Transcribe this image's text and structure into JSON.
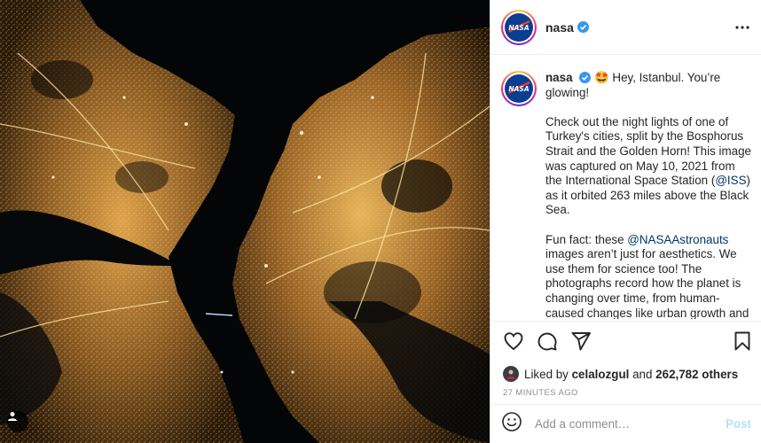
{
  "account": {
    "username": "nasa",
    "verified": true
  },
  "header": {
    "more_label": "More options"
  },
  "caption": {
    "username": "nasa",
    "emoji": "🤩",
    "line1": "Hey, Istanbul. You’re glowing!",
    "para2_a": "Check out the night lights of one of Turkey's cities, split by the Bosphorus Strait and the Golden Horn! This image was captured on May 10, 2021 from the International Space Station (",
    "mention_iss": "@ISS",
    "para2_b": ") as it orbited 263 miles above the Black Sea.",
    "para3_a": "Fun fact: these ",
    "mention_astronauts": "@NASAAstronauts",
    "para3_b": " images aren’t just for aesthetics. We use them for science too! The photographs record how the planet is changing over time, from human-caused changes like urban growth and reservoir construction, to natural"
  },
  "actions": {
    "like": "heart-icon",
    "comment": "comment-icon",
    "share": "share-icon",
    "save": "bookmark-icon"
  },
  "likes": {
    "prefix": "Liked by ",
    "user": "celalozgul",
    "middle": " and ",
    "count": "262,782 others"
  },
  "timestamp": "27 MINUTES AGO",
  "comment_box": {
    "placeholder": "Add a comment…",
    "post_label": "Post"
  },
  "colors": {
    "link": "#00376b",
    "post_button": "#b2dffc",
    "verified": "#3897f0",
    "city_light": "#d89a3a"
  }
}
